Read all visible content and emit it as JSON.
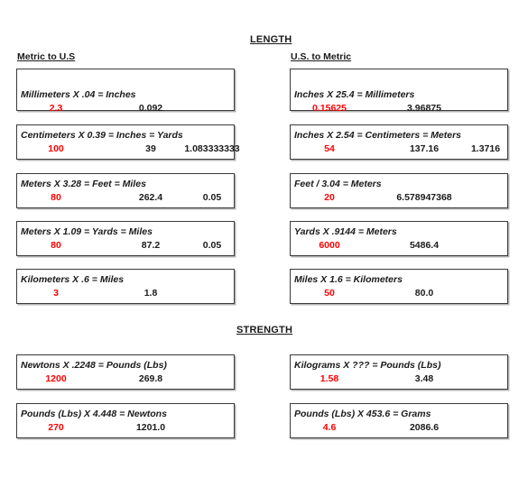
{
  "page": {
    "sections": [
      {
        "id": "length",
        "title": "LENGTH"
      },
      {
        "id": "strength",
        "title": "STRENGTH"
      }
    ],
    "column_headings": {
      "left": "Metric to U.S",
      "right": "U.S. to Metric"
    }
  },
  "colors": {
    "input_value": "#ff0000",
    "text": "#1a1a1a",
    "border": "#3a3a3a",
    "background": "#ffffff"
  },
  "length": {
    "metric_to_us": [
      {
        "formula": "Millimeters  X  .04 =  Inches",
        "input": "2.3",
        "result1": "0.092",
        "result2": ""
      },
      {
        "formula": "Centimeters  X 0.39  =  Inches  =  Yards",
        "input": "100",
        "result1": "39",
        "result2": "1.083333333"
      },
      {
        "formula": "Meters    X   3.28   =    Feet  =  Miles",
        "input": "80",
        "result1": "262.4",
        "result2": "0.05"
      },
      {
        "formula": "Meters    X  1.09  =  Yards  =  Miles",
        "input": "80",
        "result1": "87.2",
        "result2": "0.05"
      },
      {
        "formula": "Kilometers  X    .6  =  Miles",
        "input": "3",
        "result1": "1.8",
        "result2": ""
      }
    ],
    "us_to_metric": [
      {
        "formula": "Inches   X   25.4   =   Millimeters",
        "input": "0.15625",
        "result1": "3.96875",
        "result2": ""
      },
      {
        "formula": "Inches   X   2.54   = Centimeters = Meters",
        "input": "54",
        "result1": "137.16",
        "result2": "1.3716"
      },
      {
        "formula": "Feet     /    3.04   =   Meters",
        "input": "20",
        "result1": "6.578947368",
        "result2": ""
      },
      {
        "formula": "Yards   X   .9144     =   Meters",
        "input": "6000",
        "result1": "5486.4",
        "result2": ""
      },
      {
        "formula": "Miles    X  1.6     =   Kilometers",
        "input": "50",
        "result1": "80.0",
        "result2": ""
      }
    ]
  },
  "strength": {
    "left": [
      {
        "formula": "Newtons X  .2248 = Pounds (Lbs)",
        "input": "1200",
        "result1": "269.8",
        "result2": ""
      },
      {
        "formula": "Pounds (Lbs) X 4.448 = Newtons",
        "input": "270",
        "result1": "1201.0",
        "result2": ""
      }
    ],
    "right": [
      {
        "formula": "Kilograms X   ??? = Pounds (Lbs)",
        "input": "1.58",
        "result1": "3.48",
        "result2": ""
      },
      {
        "formula": "Pounds (Lbs) X 453.6 = Grams",
        "input": "4.6",
        "result1": "2086.6",
        "result2": ""
      }
    ]
  }
}
